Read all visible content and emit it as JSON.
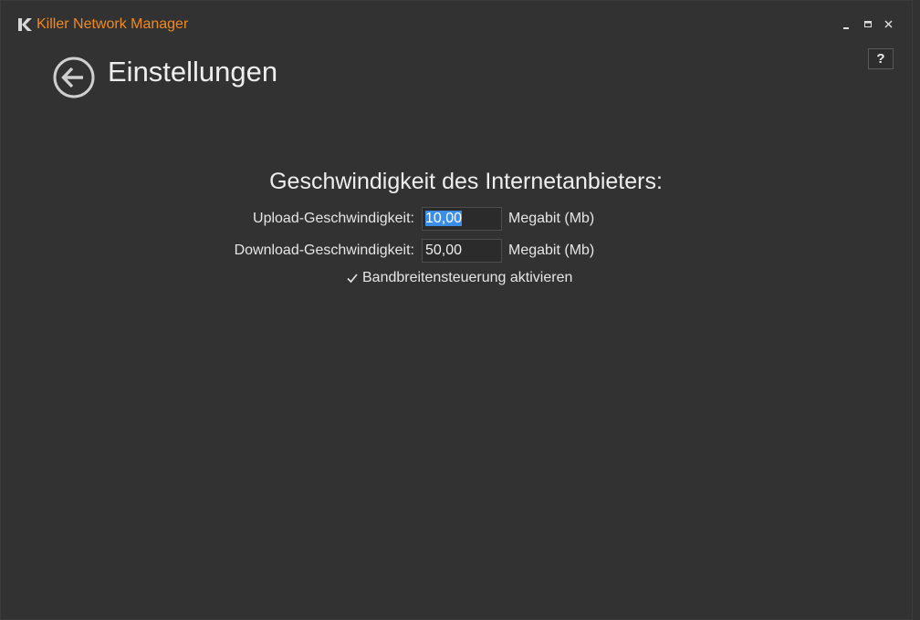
{
  "titlebar": {
    "app_title": "Killer Network Manager",
    "logo_icon": "killer-k-logo-icon",
    "minimize_icon": "minimize-icon",
    "maximize_icon": "maximize-icon",
    "close_icon": "close-icon"
  },
  "help": {
    "label": "?"
  },
  "header": {
    "back_icon": "back-arrow-circle-icon",
    "title": "Einstellungen"
  },
  "speed": {
    "heading": "Geschwindigkeit des Internetanbieters:",
    "upload": {
      "label": "Upload-Geschwindigkeit:",
      "value": "10,00",
      "unit": "Megabit (Mb)"
    },
    "download": {
      "label": "Download-Geschwindigkeit:",
      "value": "50,00",
      "unit": "Megabit (Mb)"
    },
    "bandwidth_control": {
      "label": "Bandbreitensteuerung aktivieren",
      "checked": true
    }
  },
  "colors": {
    "background": "#323232",
    "accent": "#f08a1f",
    "text": "#eeeeee",
    "selection": "#3b8ee8"
  }
}
